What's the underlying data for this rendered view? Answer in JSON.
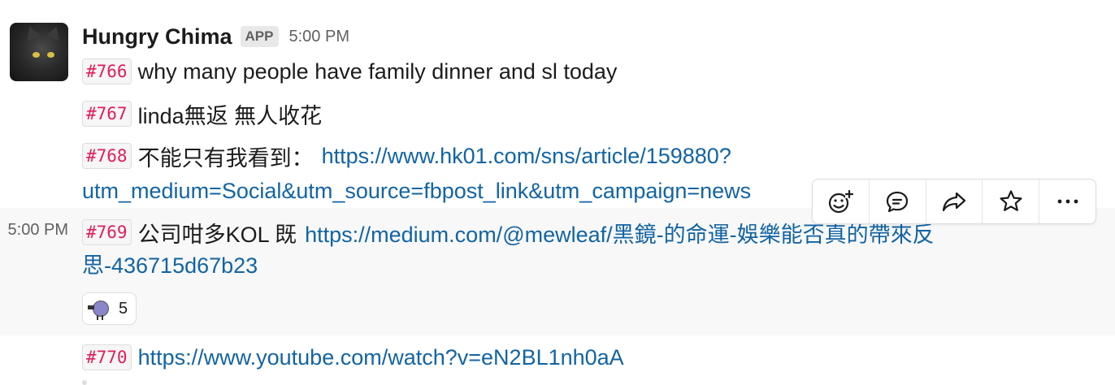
{
  "message": {
    "sender": "Hungry Chima",
    "badge": "APP",
    "time": "5:00 PM",
    "hover_time": "5:00 PM"
  },
  "lines": [
    {
      "code": "#766",
      "text": "why many people have family dinner and sl today"
    },
    {
      "code": "#767",
      "text": "linda無返 無人收花"
    },
    {
      "code": "#768",
      "text": "不能只有我看到：",
      "link_part1": "https://www.hk01.com/sns/article/159880?",
      "link_part2": "utm_medium=Social&utm_source=fbpost_link&utm_campaign=news"
    },
    {
      "code": "#769",
      "text": "公司咁多KOL 既",
      "link_part1": "https://medium.com/@mewleaf/黑鏡-的命運-娛樂能否真的帶來反",
      "link_part2": "思-436715d67b23"
    },
    {
      "code": "#770",
      "link": "https://www.youtube.com/watch?v=eN2BL1nh0aA"
    }
  ],
  "reaction": {
    "icon": "party-parrot-emoji",
    "count": "5"
  },
  "toolbar": {
    "items": [
      {
        "icon": "add-reaction-icon"
      },
      {
        "icon": "reply-thread-icon"
      },
      {
        "icon": "share-icon"
      },
      {
        "icon": "star-icon"
      },
      {
        "icon": "more-actions-icon"
      }
    ]
  },
  "colors": {
    "code_text": "#e01e5a",
    "link": "#1264a3",
    "hover_bg": "#f8f8f8",
    "text": "#1d1c1d",
    "muted": "#616061"
  }
}
